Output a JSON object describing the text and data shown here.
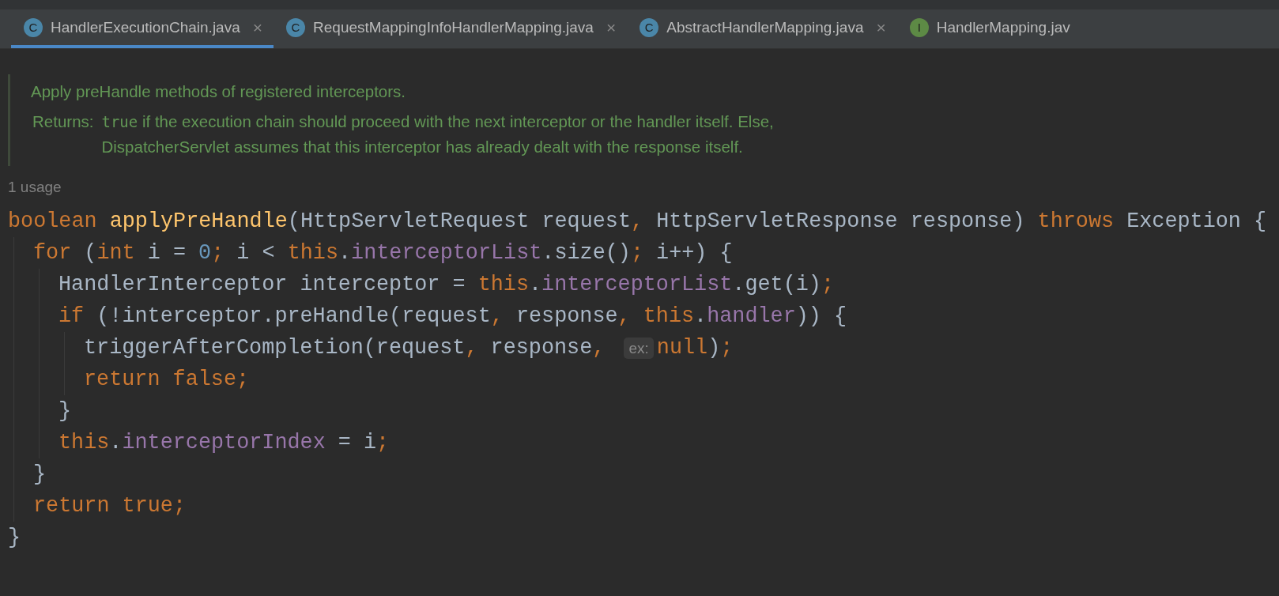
{
  "tabs": [
    {
      "icon_letter": "C",
      "color": "#4a86a8",
      "label": "HandlerExecutionChain.java",
      "close": "×",
      "selected": true
    },
    {
      "icon_letter": "C",
      "color": "#4a86a8",
      "label": "RequestMappingInfoHandlerMapping.java",
      "close": "×",
      "selected": false
    },
    {
      "icon_letter": "C",
      "color": "#4a86a8",
      "label": "AbstractHandlerMapping.java",
      "close": "×",
      "selected": false
    },
    {
      "icon_letter": "I",
      "color": "#5d8a45",
      "label": "HandlerMapping.jav",
      "selected": false
    }
  ],
  "doc": {
    "summary": "Apply preHandle methods of registered interceptors.",
    "returns_label": "Returns:",
    "returns_code": "true",
    "returns_lines": [
      " if the execution chain should proceed with the next interceptor or the handler itself. Else,",
      "DispatcherServlet assumes that this interceptor has already dealt with the response itself."
    ]
  },
  "usages": "1 usage",
  "code": [
    {
      "tokens": [
        {
          "kind": "keyword",
          "text": "boolean "
        },
        {
          "kind": "method",
          "text": "applyPreHandle"
        },
        {
          "kind": "plain",
          "text": "(HttpServletRequest request"
        },
        {
          "kind": "keyword",
          "text": ", "
        },
        {
          "kind": "plain",
          "text": "HttpServletResponse response) "
        },
        {
          "kind": "keyword",
          "text": "throws "
        },
        {
          "kind": "plain",
          "text": "Exception {"
        }
      ],
      "children": [
        {
          "tokens": [
            {
              "kind": "keyword",
              "text": "for "
            },
            {
              "kind": "plain",
              "text": "("
            },
            {
              "kind": "keyword",
              "text": "int "
            },
            {
              "kind": "plain",
              "text": "i = "
            },
            {
              "kind": "number",
              "text": "0"
            },
            {
              "kind": "keyword",
              "text": "; "
            },
            {
              "kind": "plain",
              "text": "i < "
            },
            {
              "kind": "keyword",
              "text": "this"
            },
            {
              "kind": "plain",
              "text": "."
            },
            {
              "kind": "field",
              "text": "interceptorList"
            },
            {
              "kind": "plain",
              "text": ".size()"
            },
            {
              "kind": "keyword",
              "text": "; "
            },
            {
              "kind": "plain",
              "text": "i++) {"
            }
          ],
          "children": [
            {
              "tokens": [
                {
                  "kind": "plain",
                  "text": "HandlerInterceptor interceptor = "
                },
                {
                  "kind": "keyword",
                  "text": "this"
                },
                {
                  "kind": "plain",
                  "text": "."
                },
                {
                  "kind": "field",
                  "text": "interceptorList"
                },
                {
                  "kind": "plain",
                  "text": ".get(i)"
                },
                {
                  "kind": "keyword",
                  "text": ";"
                }
              ]
            },
            {
              "tokens": [
                {
                  "kind": "keyword",
                  "text": "if "
                },
                {
                  "kind": "plain",
                  "text": "(!interceptor.preHandle(request"
                },
                {
                  "kind": "keyword",
                  "text": ", "
                },
                {
                  "kind": "plain",
                  "text": "response"
                },
                {
                  "kind": "keyword",
                  "text": ", this"
                },
                {
                  "kind": "plain",
                  "text": "."
                },
                {
                  "kind": "field",
                  "text": "handler"
                },
                {
                  "kind": "plain",
                  "text": ")) {"
                }
              ],
              "children": [
                {
                  "tokens": [
                    {
                      "kind": "plain",
                      "text": "triggerAfterCompletion(request"
                    },
                    {
                      "kind": "keyword",
                      "text": ", "
                    },
                    {
                      "kind": "plain",
                      "text": "response"
                    },
                    {
                      "kind": "keyword",
                      "text": ", "
                    },
                    {
                      "kind": "hint",
                      "text": "ex:"
                    },
                    {
                      "kind": "keyword",
                      "text": "null"
                    },
                    {
                      "kind": "plain",
                      "text": ")"
                    },
                    {
                      "kind": "keyword",
                      "text": ";"
                    }
                  ]
                },
                {
                  "tokens": [
                    {
                      "kind": "keyword",
                      "text": "return false;"
                    }
                  ]
                }
              ]
            },
            {
              "tokens": [
                {
                  "kind": "plain",
                  "text": "}"
                }
              ]
            },
            {
              "tokens": [
                {
                  "kind": "keyword",
                  "text": "this"
                },
                {
                  "kind": "plain",
                  "text": "."
                },
                {
                  "kind": "field",
                  "text": "interceptorIndex"
                },
                {
                  "kind": "plain",
                  "text": " = i"
                },
                {
                  "kind": "keyword",
                  "text": ";"
                }
              ]
            }
          ]
        },
        {
          "tokens": [
            {
              "kind": "plain",
              "text": "}"
            }
          ]
        },
        {
          "tokens": [
            {
              "kind": "keyword",
              "text": "return true;"
            }
          ]
        }
      ]
    },
    {
      "tokens": [
        {
          "kind": "plain",
          "text": "}"
        }
      ]
    }
  ]
}
